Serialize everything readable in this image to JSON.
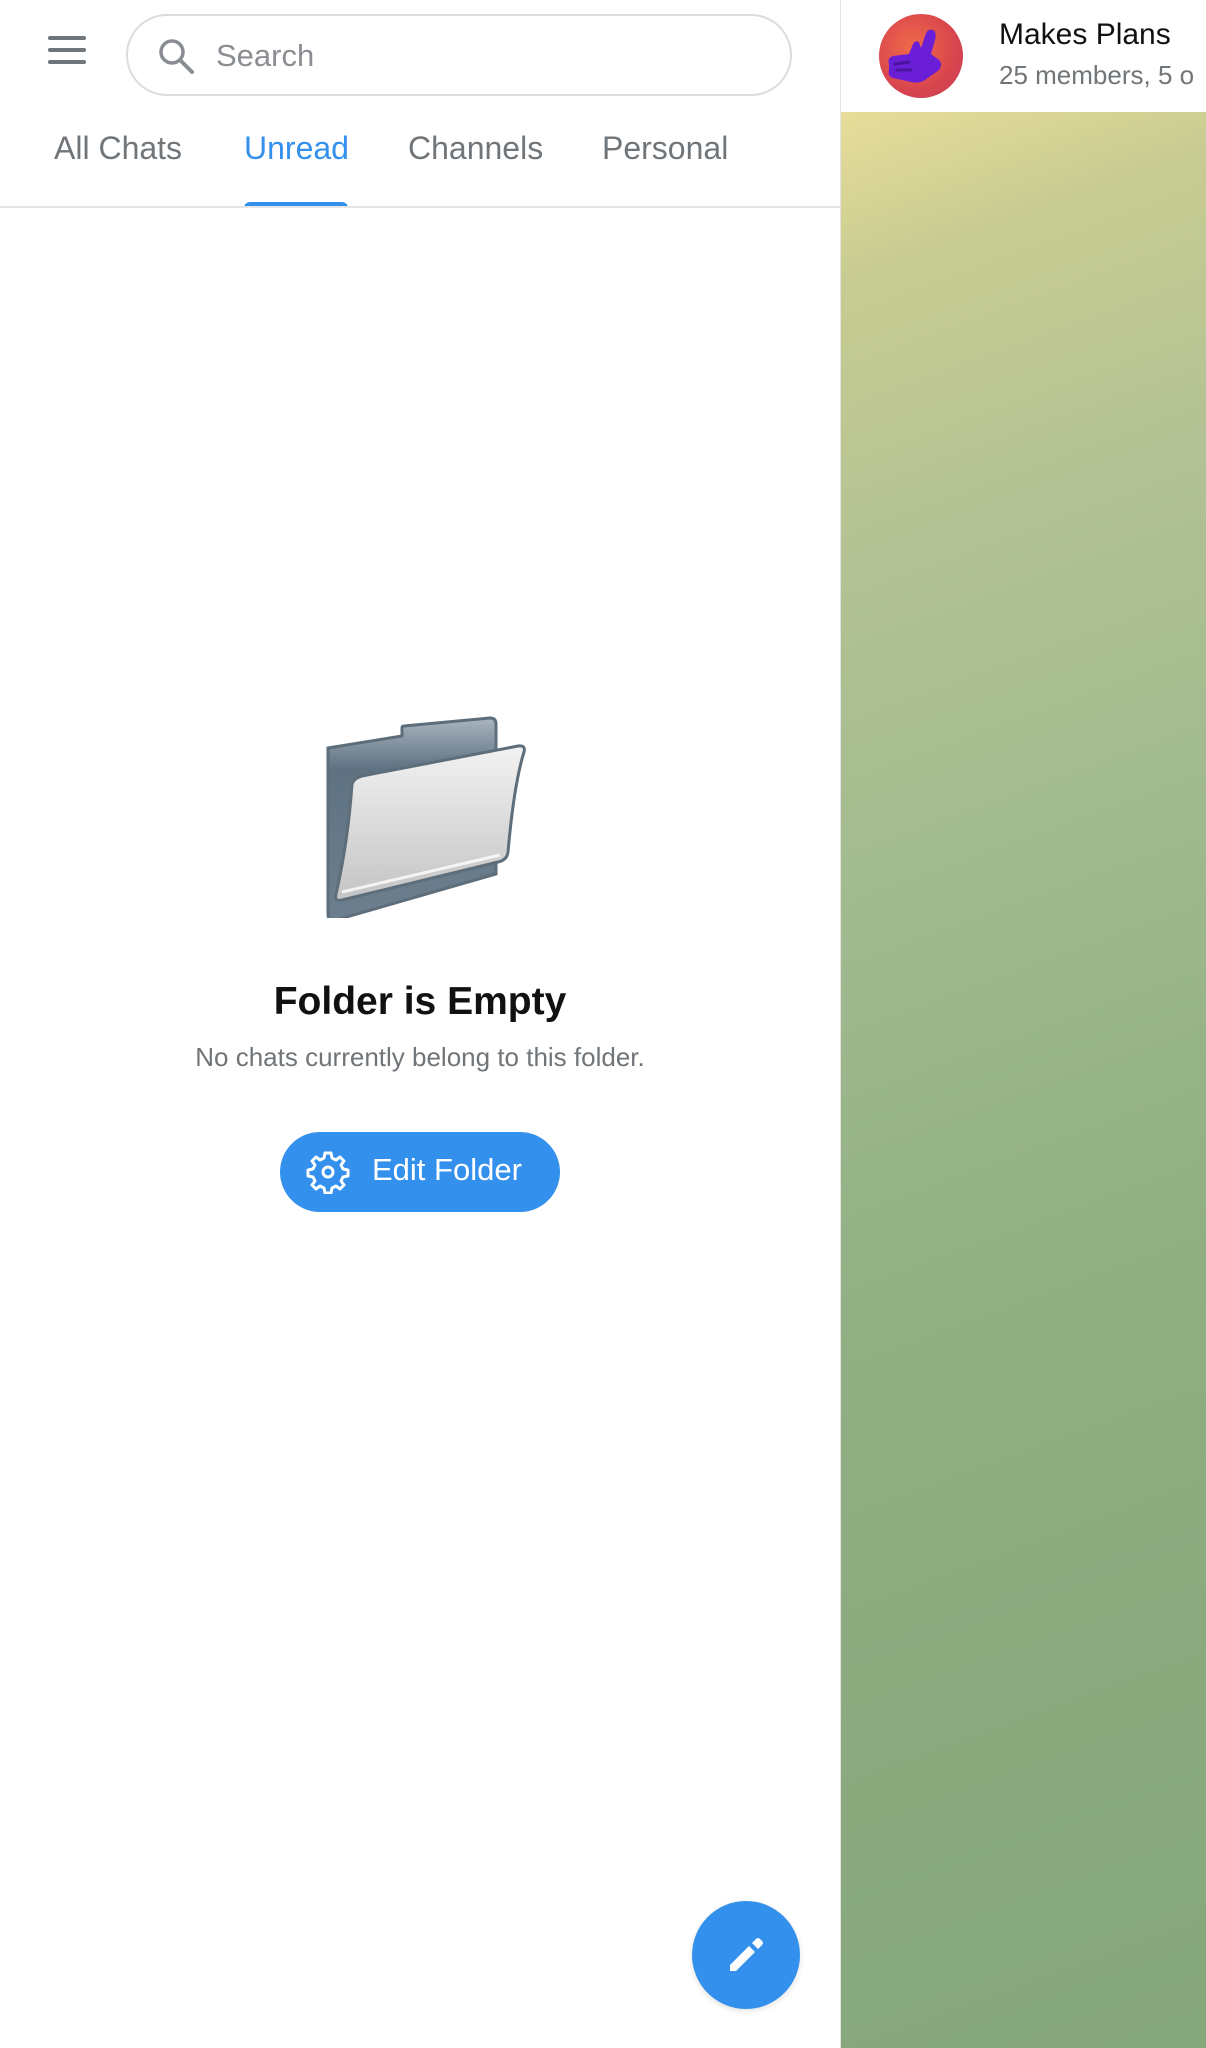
{
  "sidebar": {
    "search": {
      "placeholder": "Search",
      "value": ""
    },
    "tabs": [
      {
        "label": "All Chats",
        "active": false
      },
      {
        "label": "Unread",
        "active": true
      },
      {
        "label": "Channels",
        "active": false
      },
      {
        "label": "Personal",
        "active": false
      }
    ],
    "empty_state": {
      "title": "Folder is Empty",
      "subtitle": "No chats currently belong to this folder.",
      "button_label": "Edit Folder"
    },
    "fab_icon": "pencil-icon"
  },
  "chat": {
    "title": "Makes Plans",
    "subtitle": "25 members, 5 o",
    "avatar_icon": "call-me-hand-icon"
  },
  "colors": {
    "accent": "#3390ec",
    "text_secondary": "#707579",
    "avatar": "#e05a50",
    "wallpaper_top": "#e8dd9a",
    "wallpaper_bottom": "#86a67c"
  }
}
